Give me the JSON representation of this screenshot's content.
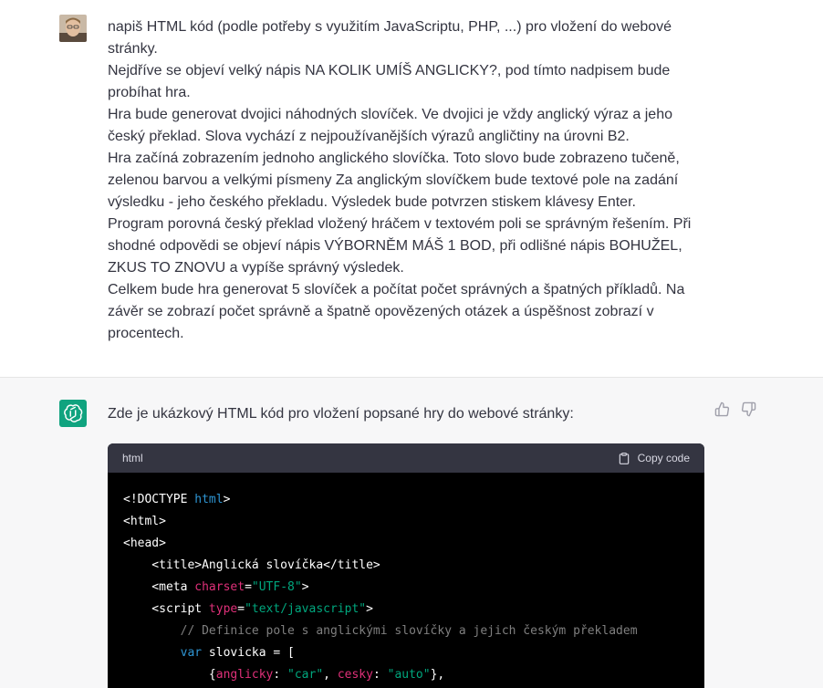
{
  "user_message": {
    "paragraphs": [
      "napiš HTML kód (podle potřeby s využitím JavaScriptu, PHP, ...) pro vložení do webové stránky.",
      "Nejdříve se objeví velký nápis NA KOLIK UMÍŠ ANGLICKY?, pod tímto nadpisem bude probíhat hra.",
      "Hra bude generovat dvojici náhodných slovíček. Ve dvojici je vždy anglický výraz a jeho český překlad. Slova vychází z nejpoužívanějších výrazů angličtiny na úrovni B2.",
      "Hra začíná zobrazením jednoho anglického slovíčka. Toto slovo bude zobrazeno tučeně, zelenou barvou a velkými písmeny Za anglickým slovíčkem bude textové pole na zadání výsledku - jeho českého překladu. Výsledek bude potvrzen stiskem klávesy Enter.",
      "Program porovná český překlad vložený hráčem v textovém poli se správným řešením. Při shodné odpovědi se objeví nápis VÝBORNĚM MÁŠ 1 BOD, při odlišné nápis BOHUŽEL, ZKUS TO ZNOVU a vypíše správný výsledek.",
      "Celkem bude hra generovat 5 slovíček a počítat počet správných a špatných příkladů. Na závěr se zobrazí počet správně a špatně opovězených otázek a úspěšnost zobrazí v procentech."
    ]
  },
  "assistant_message": {
    "intro": "Zde je ukázkový HTML kód pro vložení popsané hry do webové stránky:",
    "code_language": "html",
    "copy_label": "Copy code",
    "code_lines": [
      "<!DOCTYPE html>",
      "<html>",
      "<head>",
      "    <title>Anglická slovíčka</title>",
      "    <meta charset=\"UTF-8\">",
      "    <script type=\"text/javascript\">",
      "        // Definice pole s anglickými slovíčky a jejich českým překladem",
      "        var slovicka = [",
      "            {anglicky: \"car\", cesky: \"auto\"},"
    ]
  },
  "icons": {
    "user_avatar": "user-avatar-photo",
    "bot_avatar": "openai-logo-icon",
    "copy": "clipboard-icon",
    "like": "thumbs-up-icon",
    "dislike": "thumbs-down-icon"
  },
  "colors": {
    "bot_avatar_bg": "#10a37f",
    "code_bg": "#000000",
    "code_header_bg": "#343541"
  }
}
